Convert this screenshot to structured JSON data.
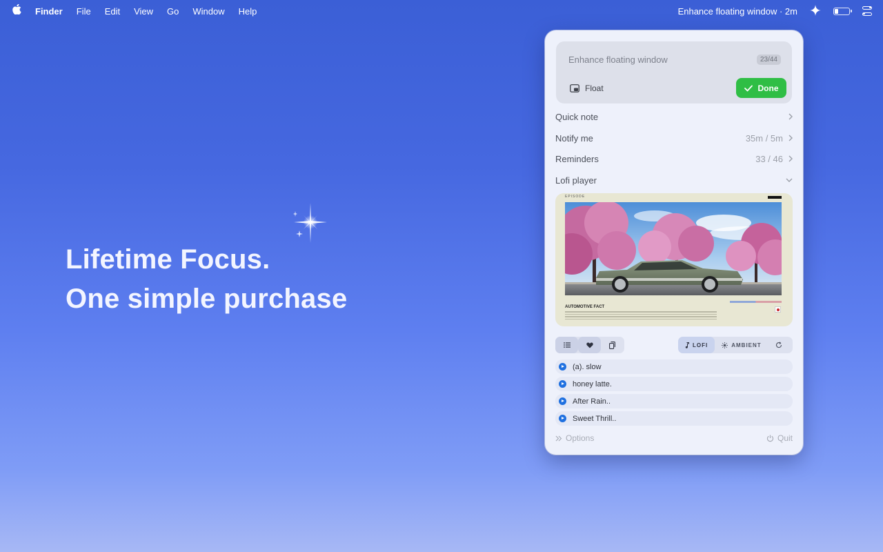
{
  "menubar": {
    "app_name": "Finder",
    "menus": [
      "File",
      "Edit",
      "View",
      "Go",
      "Window",
      "Help"
    ],
    "status_text": "Enhance floating window · 2m"
  },
  "hero": {
    "line1": "Lifetime Focus.",
    "line2": "One simple purchase"
  },
  "panel": {
    "task": {
      "title": "Enhance floating window",
      "count": "23/44",
      "float_label": "Float",
      "done_label": "Done"
    },
    "rows": {
      "quick_note": "Quick note",
      "notify_label": "Notify me",
      "notify_value": "35m / 5m",
      "reminders_label": "Reminders",
      "reminders_value": "33 / 46",
      "lofi_label": "Lofi player"
    },
    "artwork": {
      "episode": "EPISODE",
      "fact_title": "AUTOMOTIVE FACT"
    },
    "modes": {
      "lofi": "LOFI",
      "ambient": "AMBIENT"
    },
    "tracks": [
      "(a). slow",
      "honey latte.",
      "After Rain..",
      "Sweet Thrill.."
    ],
    "footer": {
      "options": "Options",
      "quit": "Quit"
    }
  },
  "colors": {
    "done_green": "#2fbe45",
    "play_blue": "#1f70e0"
  }
}
